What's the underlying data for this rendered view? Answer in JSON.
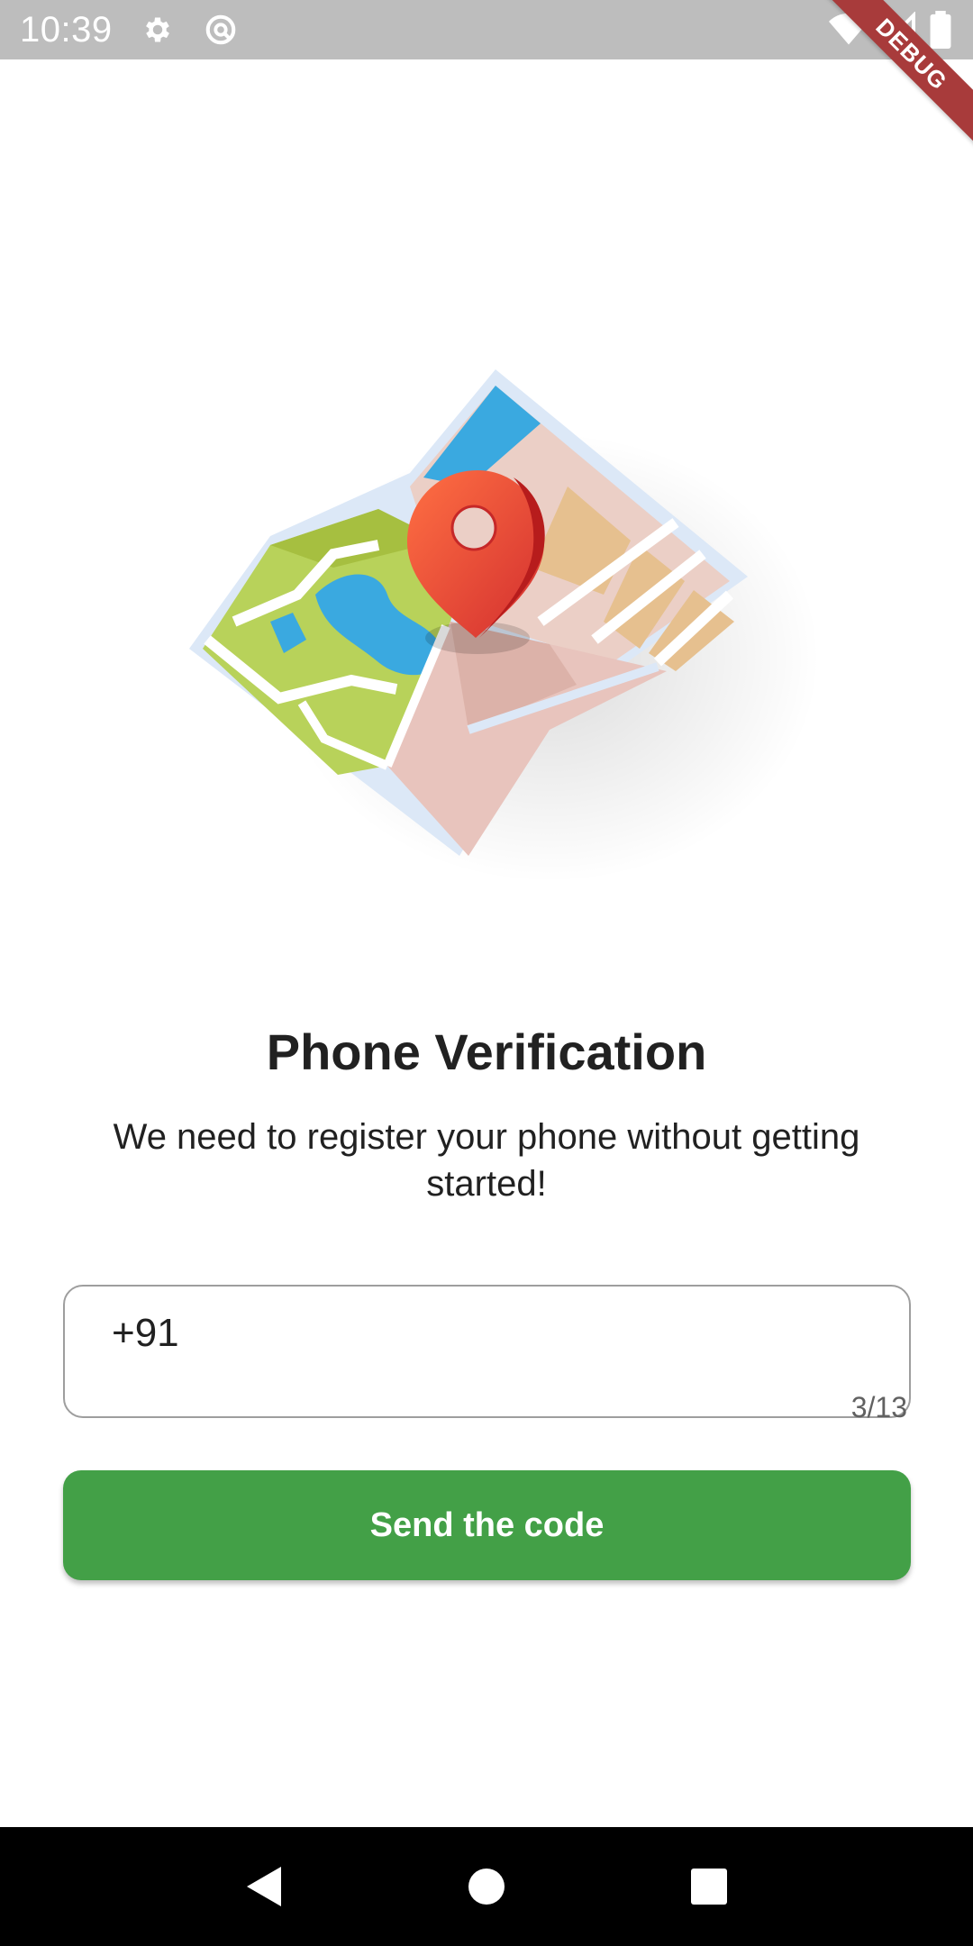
{
  "status_bar": {
    "time": "10:39",
    "icons": [
      "gear-icon",
      "sync-icon",
      "wifi-icon",
      "signal-icon",
      "battery-icon"
    ],
    "debug_label": "DEBUG"
  },
  "main": {
    "illustration": "map-with-location-pin",
    "title": "Phone Verification",
    "subtitle": "We need to register your phone without getting started!",
    "phone_field": {
      "value": "+91",
      "counter": "3/13"
    },
    "send_button_label": "Send the code"
  },
  "nav_bar": {
    "buttons": [
      "back-icon",
      "home-icon",
      "recents-icon"
    ]
  },
  "colors": {
    "accent": "#43a047",
    "status_bar": "#bdbdbd",
    "debug_banner": "#a83b3b",
    "pin": "#e53935"
  }
}
